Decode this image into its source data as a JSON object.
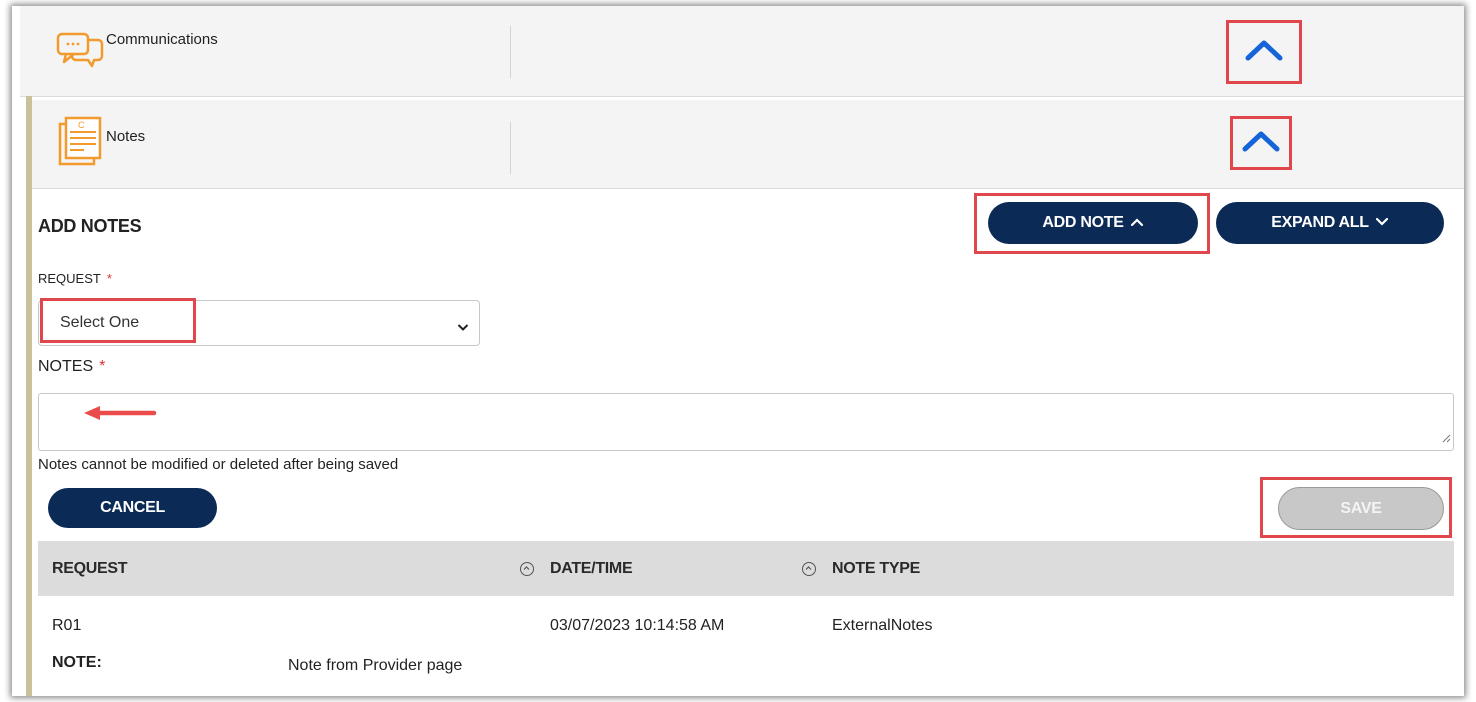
{
  "sections": {
    "communications": {
      "title": "Communications",
      "icon": "chat-bubbles-icon"
    },
    "notes": {
      "title": "Notes",
      "icon": "notes-document-icon"
    }
  },
  "add_notes": {
    "heading": "ADD NOTES",
    "add_note_button": "ADD NOTE",
    "expand_all_button": "EXPAND ALL",
    "request_label": "REQUEST",
    "request_required": "*",
    "request_select_value": "Select One",
    "notes_label": "NOTES",
    "notes_required": "*",
    "notes_value": "",
    "disclaimer": "Notes cannot be modified or deleted after being saved",
    "cancel_button": "CANCEL",
    "save_button": "SAVE"
  },
  "table": {
    "columns": [
      "REQUEST",
      "DATE/TIME",
      "NOTE TYPE"
    ],
    "rows": [
      {
        "request": "R01",
        "datetime": "03/07/2023 10:14:58 AM",
        "note_type": "ExternalNotes",
        "note_label": "NOTE:",
        "note_text": "Note from Provider page"
      }
    ]
  },
  "colors": {
    "primary_button": "#0b2a55",
    "highlight_box": "#e0474c",
    "chevron": "#1565d8",
    "icon_orange": "#f29a2e",
    "required": "#dd3333"
  }
}
